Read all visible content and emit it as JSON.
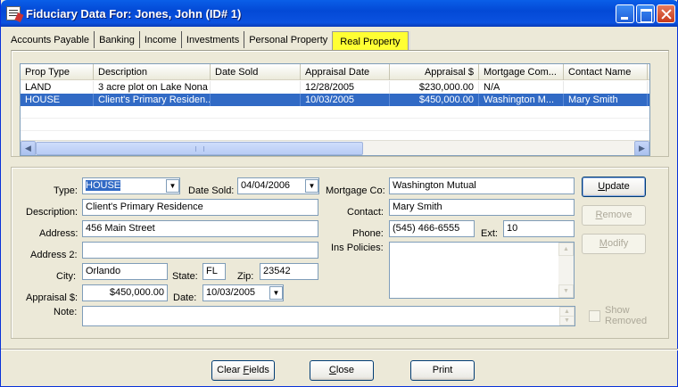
{
  "window": {
    "title": "Fiduciary Data For: Jones, John (ID# 1)"
  },
  "tabs": [
    {
      "label": "Accounts Payable"
    },
    {
      "label": "Banking"
    },
    {
      "label": "Income"
    },
    {
      "label": "Investments"
    },
    {
      "label": "Personal Property"
    },
    {
      "label": "Real Property",
      "active": true
    }
  ],
  "grid": {
    "columns": [
      "Prop Type",
      "Description",
      "Date Sold",
      "Appraisal Date",
      "Appraisal $",
      "Mortgage Com...",
      "Contact Name"
    ],
    "rows": [
      {
        "type": "LAND",
        "description": "3 acre plot on Lake Nona",
        "date_sold": "",
        "appraisal_date": "12/28/2005",
        "appraisal": "$230,000.00",
        "mortgage": "N/A",
        "contact": ""
      },
      {
        "type": "HOUSE",
        "description": "Client's Primary Residen...",
        "date_sold": "",
        "appraisal_date": "10/03/2005",
        "appraisal": "$450,000.00",
        "mortgage": "Washington M...",
        "contact": "Mary Smith"
      }
    ],
    "selected_row": 1,
    "scroll_icons": {
      "left": "chevron-left-icon",
      "right": "chevron-right-icon",
      "grip": "grip-icon"
    }
  },
  "form": {
    "type": {
      "label": "Type:",
      "value": "HOUSE"
    },
    "date_sold": {
      "label": "Date Sold:",
      "value": "04/04/2006"
    },
    "description": {
      "label": "Description:",
      "value": "Client's Primary Residence"
    },
    "address": {
      "label": "Address:",
      "value": "456 Main Street"
    },
    "address2": {
      "label": "Address 2:",
      "value": ""
    },
    "city": {
      "label": "City:",
      "value": "Orlando"
    },
    "state": {
      "label": "State:",
      "value": "FL"
    },
    "zip": {
      "label": "Zip:",
      "value": "23542"
    },
    "appraisal": {
      "label": "Appraisal $:",
      "value": "$450,000.00"
    },
    "appraisal_date": {
      "label": "Date:",
      "value": "10/03/2005"
    },
    "note": {
      "label": "Note:",
      "value": ""
    },
    "mortgage_co": {
      "label": "Mortgage Co:",
      "value": "Washington Mutual"
    },
    "contact": {
      "label": "Contact:",
      "value": "Mary Smith"
    },
    "phone": {
      "label": "Phone:",
      "value": "(545) 466-6555"
    },
    "ext": {
      "label": "Ext:",
      "value": "10"
    },
    "ins_policies": {
      "label": "Ins Policies:",
      "value": ""
    }
  },
  "side_buttons": {
    "update": {
      "first": "U",
      "rest": "pdate"
    },
    "remove": {
      "first": "R",
      "rest": "emove"
    },
    "modify": {
      "first": "M",
      "rest": "odify"
    }
  },
  "show_removed": {
    "line1": "Show",
    "line2": "Removed",
    "checked": false
  },
  "bottom_buttons": {
    "clear": {
      "pre": "Clear ",
      "ul": "F",
      "post": "ields"
    },
    "close": {
      "pre": "",
      "ul": "C",
      "post": "lose"
    },
    "print": {
      "label": "Print"
    }
  },
  "colors": {
    "titlebar": "#0A5FE8",
    "selection": "#316AC5",
    "active_tab": "#FFFF33",
    "face": "#ECE9D8"
  }
}
